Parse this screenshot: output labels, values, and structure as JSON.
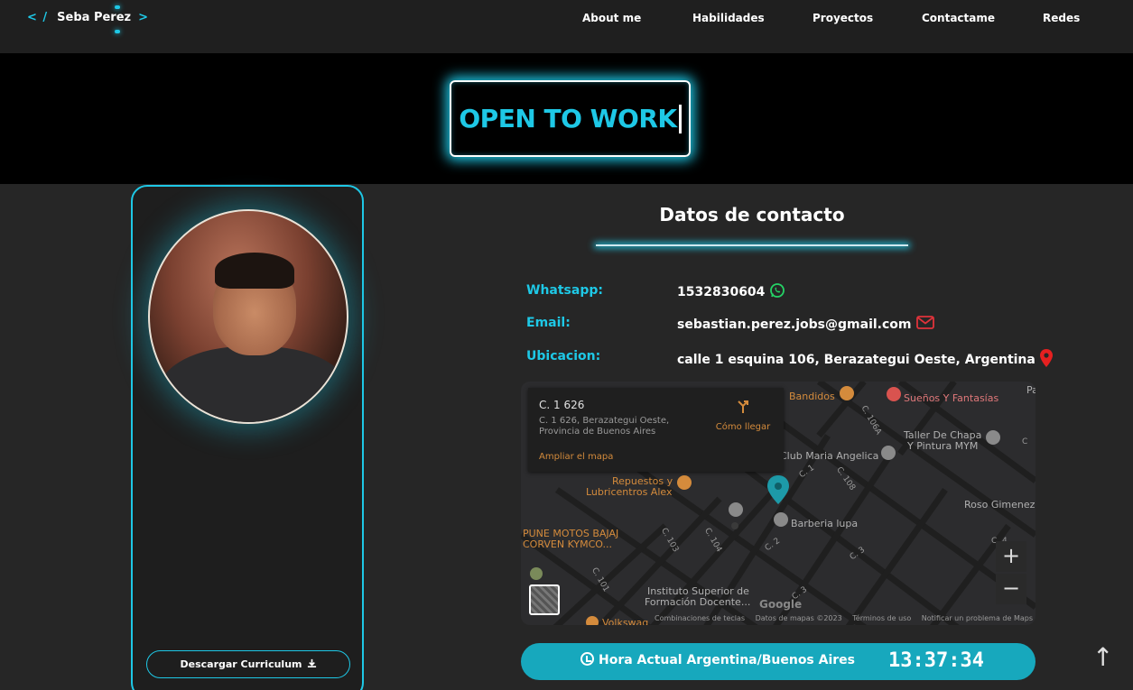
{
  "brand": {
    "open": "< /",
    "name": "Seba Perez",
    "close": ">"
  },
  "nav": [
    "About me",
    "Habilidades",
    "Proyectos",
    "Contactame",
    "Redes"
  ],
  "hero": {
    "text": "OPEN TO WORK"
  },
  "profile": {
    "cv_label": "Descargar Curriculum",
    "cv_icon": "download-icon"
  },
  "contact": {
    "title": "Datos de contacto",
    "rows": [
      {
        "label": "Whatsapp:",
        "value": "1532830604",
        "icon": "whatsapp-icon",
        "color": "#25d366"
      },
      {
        "label": "Email:",
        "value": "sebastian.perez.jobs@gmail.com",
        "icon": "envelope-icon",
        "color": "#e0333b"
      },
      {
        "label": "Ubicacion:",
        "value": "calle 1 esquina 106, Berazategui Oeste, Argentina",
        "icon": "map-pin-icon",
        "color": "#e52020"
      }
    ]
  },
  "map": {
    "place_title": "C. 1 626",
    "place_address": "C. 1 626, Berazategui Oeste, Provincia de Buenos Aires",
    "directions_label": "Cómo llegar",
    "enlarge_label": "Ampliar el mapa",
    "zoom_in": "+",
    "zoom_out": "−",
    "google": "Google",
    "footer": [
      "Combinaciones de teclas",
      "Datos de mapas ©2023",
      "Términos de uso",
      "Notificar un problema de Maps"
    ],
    "labels": [
      "Bandidos",
      "Sueños Y Fantasías",
      "Taller De Chapa",
      "Y Pintura MYM",
      "Club Maria Angelica",
      "Repuestos y",
      "Lubricentros Alex",
      "Roso Gimenez",
      "Barberia lupa",
      "PUNE MOTOS BAJAJ",
      "CORVEN KYMCO...",
      "Instituto Superior de",
      "Formación Docente...",
      "Volkswag",
      "C. 106A",
      "C. 1",
      "C. 108",
      "C. 103",
      "C. 104",
      "C. 2",
      "C. 3",
      "C. 101",
      "C. 3",
      "C. 4",
      "C",
      "Pa"
    ]
  },
  "clock": {
    "label": "Hora Actual Argentina/Buenos Aires",
    "time": "13:37:34"
  },
  "scroll_top": "↑"
}
